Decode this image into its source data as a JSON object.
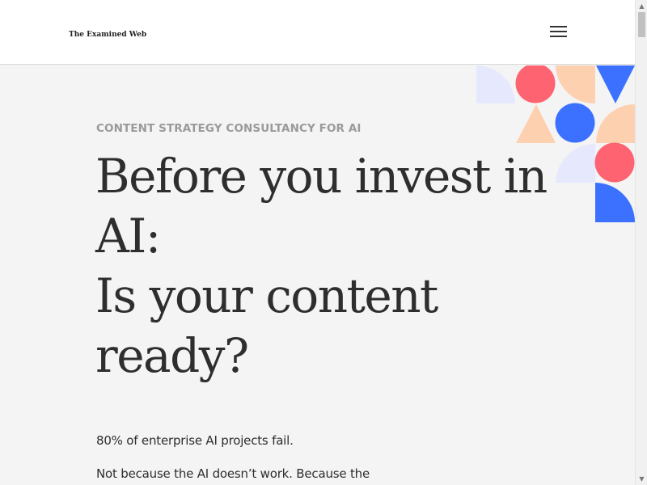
{
  "header": {
    "logo_text": "The Examined Web",
    "menu_icon": "hamburger-menu-icon"
  },
  "hero": {
    "eyebrow": "CONTENT STRATEGY CONSULTANCY FOR AI",
    "headline_lines": [
      "Before you invest in",
      "AI:",
      "Is your content",
      "ready?"
    ],
    "paragraph_1": "80% of enterprise AI projects fail.",
    "paragraph_2": "Not because the AI doesn’t work. Because the"
  },
  "colors": {
    "coral": "#fd6370",
    "peach": "#fdd1b0",
    "blue": "#3b71fe",
    "lavender": "#e6e9fd",
    "background": "#f4f4f4",
    "text": "#2e2e2e",
    "muted": "#9a9a9a"
  },
  "scrollbar": {
    "up_icon": "scroll-up-arrow-icon",
    "down_icon": "scroll-down-arrow-icon"
  }
}
